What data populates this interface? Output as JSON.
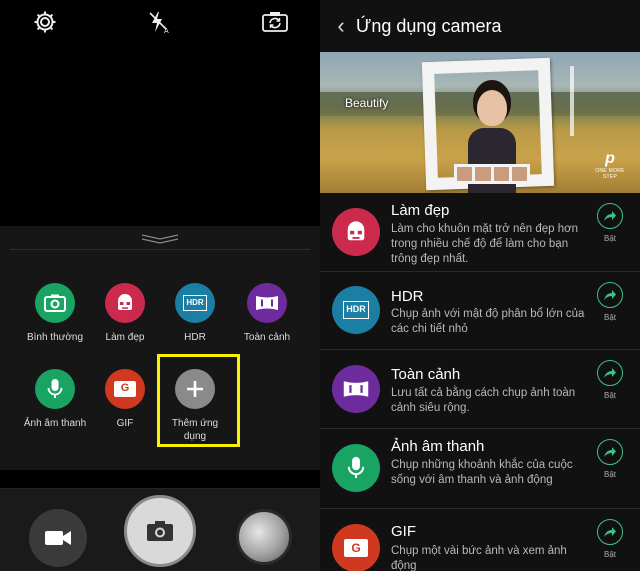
{
  "left_panel": {
    "modes": [
      {
        "id": "normal",
        "label": "Bình thường",
        "color": "#1aa463"
      },
      {
        "id": "beauty",
        "label": "Làm đẹp",
        "color": "#cc2a4c"
      },
      {
        "id": "hdr",
        "label": "HDR",
        "color": "#1b7ea3",
        "icon_text": "HDR"
      },
      {
        "id": "panorama",
        "label": "Toàn cảnh",
        "color": "#6e2b9e"
      },
      {
        "id": "audio",
        "label": "Ảnh âm thanh",
        "color": "#1aa463"
      },
      {
        "id": "gif",
        "label": "GIF",
        "color": "#d0381f",
        "icon_text": "G"
      },
      {
        "id": "add",
        "label": "Thêm ứng dụng",
        "color": "#8a8a8a"
      }
    ],
    "highlight_color": "#f7f000"
  },
  "right_panel": {
    "title": "Ứng dụng camera",
    "banner": {
      "label": "Beautify",
      "brand_tagline": "ONE MORE STEP"
    },
    "items": [
      {
        "name": "Làm đẹp",
        "desc": "Làm cho khuôn mặt trở nên đẹp hơn trong nhiều chế độ để làm cho bạn trông đẹp nhất.",
        "color": "#cc2a4c",
        "action": "Bật"
      },
      {
        "name": "HDR",
        "desc": "Chụp ảnh với mật độ phân bổ lớn của các chi tiết nhỏ",
        "color": "#1b7ea3",
        "icon_text": "HDR",
        "action": "Bật"
      },
      {
        "name": "Toàn cảnh",
        "desc": "Lưu tất cả bằng cách chụp ảnh toàn cảnh siêu rộng.",
        "color": "#6e2b9e",
        "action": "Bật"
      },
      {
        "name": "Ảnh âm thanh",
        "desc": "Chụp những khoảnh khắc của cuộc sống với âm thanh và ảnh động",
        "color": "#1aa463",
        "action": "Bật"
      },
      {
        "name": "GIF",
        "desc": "Chụp một vài bức ảnh và xem ảnh động",
        "color": "#d0381f",
        "icon_text": "G",
        "action": "Bật"
      }
    ],
    "action_color": "#3fbf8a"
  }
}
